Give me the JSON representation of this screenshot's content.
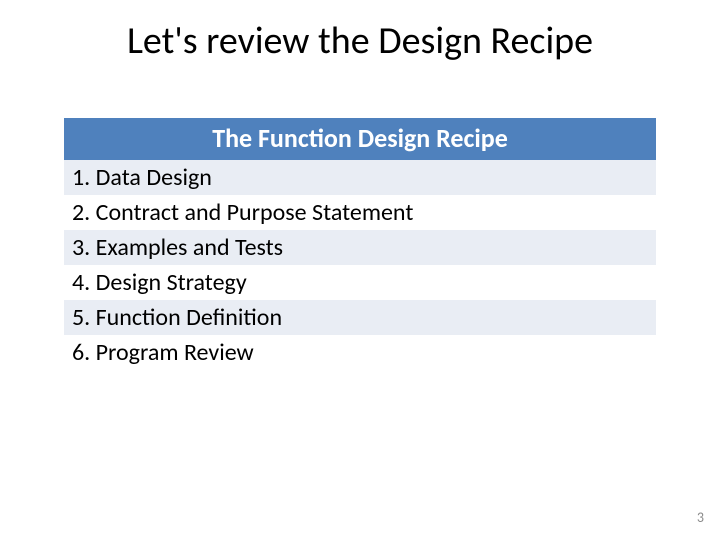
{
  "slide": {
    "title": "Let's review the Design Recipe",
    "table": {
      "header": "The Function Design Recipe",
      "rows": [
        "1. Data Design",
        "2. Contract and Purpose Statement",
        "3. Examples and Tests",
        "4. Design Strategy",
        "5. Function Definition",
        "6. Program Review"
      ]
    },
    "page_number": "3"
  }
}
